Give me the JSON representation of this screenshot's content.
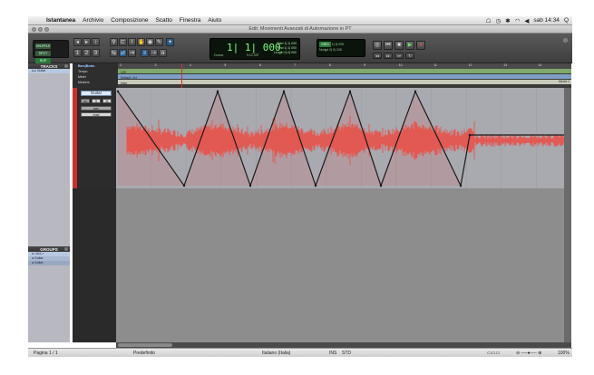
{
  "menubar": {
    "apple": "",
    "items": [
      "Istantanea",
      "Archivio",
      "Composizione",
      "Scatto",
      "Finestra",
      "Aiuto"
    ],
    "clock": "sab 14:34",
    "search": "Q"
  },
  "window": {
    "title": "Edit: Movimenti Avanzati di Automazione in PT"
  },
  "toolbar": {
    "mode_shuffle": "SHUFFLE",
    "mode_spot": "SPOT",
    "mode_slip": "SLIP",
    "mode_grid": "GRID",
    "main_counter": "1| 1| 000",
    "counter_label": "Cursor",
    "counter_value": "0:12.397",
    "start_label": "Start",
    "end_label": "End",
    "length_label": "Length",
    "start_value": "1| 1| 000",
    "end_value": "1| 1| 000",
    "length_value": "0| 0| 000",
    "grid_label": "GRID",
    "grid_value": "1| 0| 000",
    "nudge_label": "Nudge",
    "nudge_value": "0| 0| 240"
  },
  "tracks_panel": {
    "title": "TRACKS",
    "rows": [
      "Guitar"
    ]
  },
  "groups_panel": {
    "title": "GROUPS",
    "rows": [
      "<ALL>",
      "Guitar",
      "Guitar"
    ]
  },
  "rulers": {
    "bars_label": "Bars|Beats",
    "tempo_label": "Tempo",
    "meter_label": "Meter",
    "markers_label": "Markers",
    "tempo_value": "120",
    "meter_value": "Default: 4/4",
    "marker_value": "Intro",
    "marker_right": "Strofa 1",
    "bar_numbers": [
      "2",
      "3",
      "4",
      "5",
      "6",
      "7",
      "8",
      "9",
      "10",
      "11",
      "12",
      "13",
      "14"
    ]
  },
  "track": {
    "name": "Guitar",
    "rec": "rec",
    "solo": "S",
    "mute": "M",
    "view": "wav",
    "auto": "read"
  },
  "status": {
    "page": "Pagina 1 / 1",
    "preset": "Predefinito",
    "language": "Italiano (Italia)",
    "ins": "INS",
    "std": "STD",
    "zoom": "100%"
  },
  "colors": {
    "waveform": "#e8524a",
    "automation_line": "#1a1a1a",
    "edit_bg": "#a9a9b0",
    "track_strip": "#c8322b",
    "counter_text": "#7fff7f"
  }
}
